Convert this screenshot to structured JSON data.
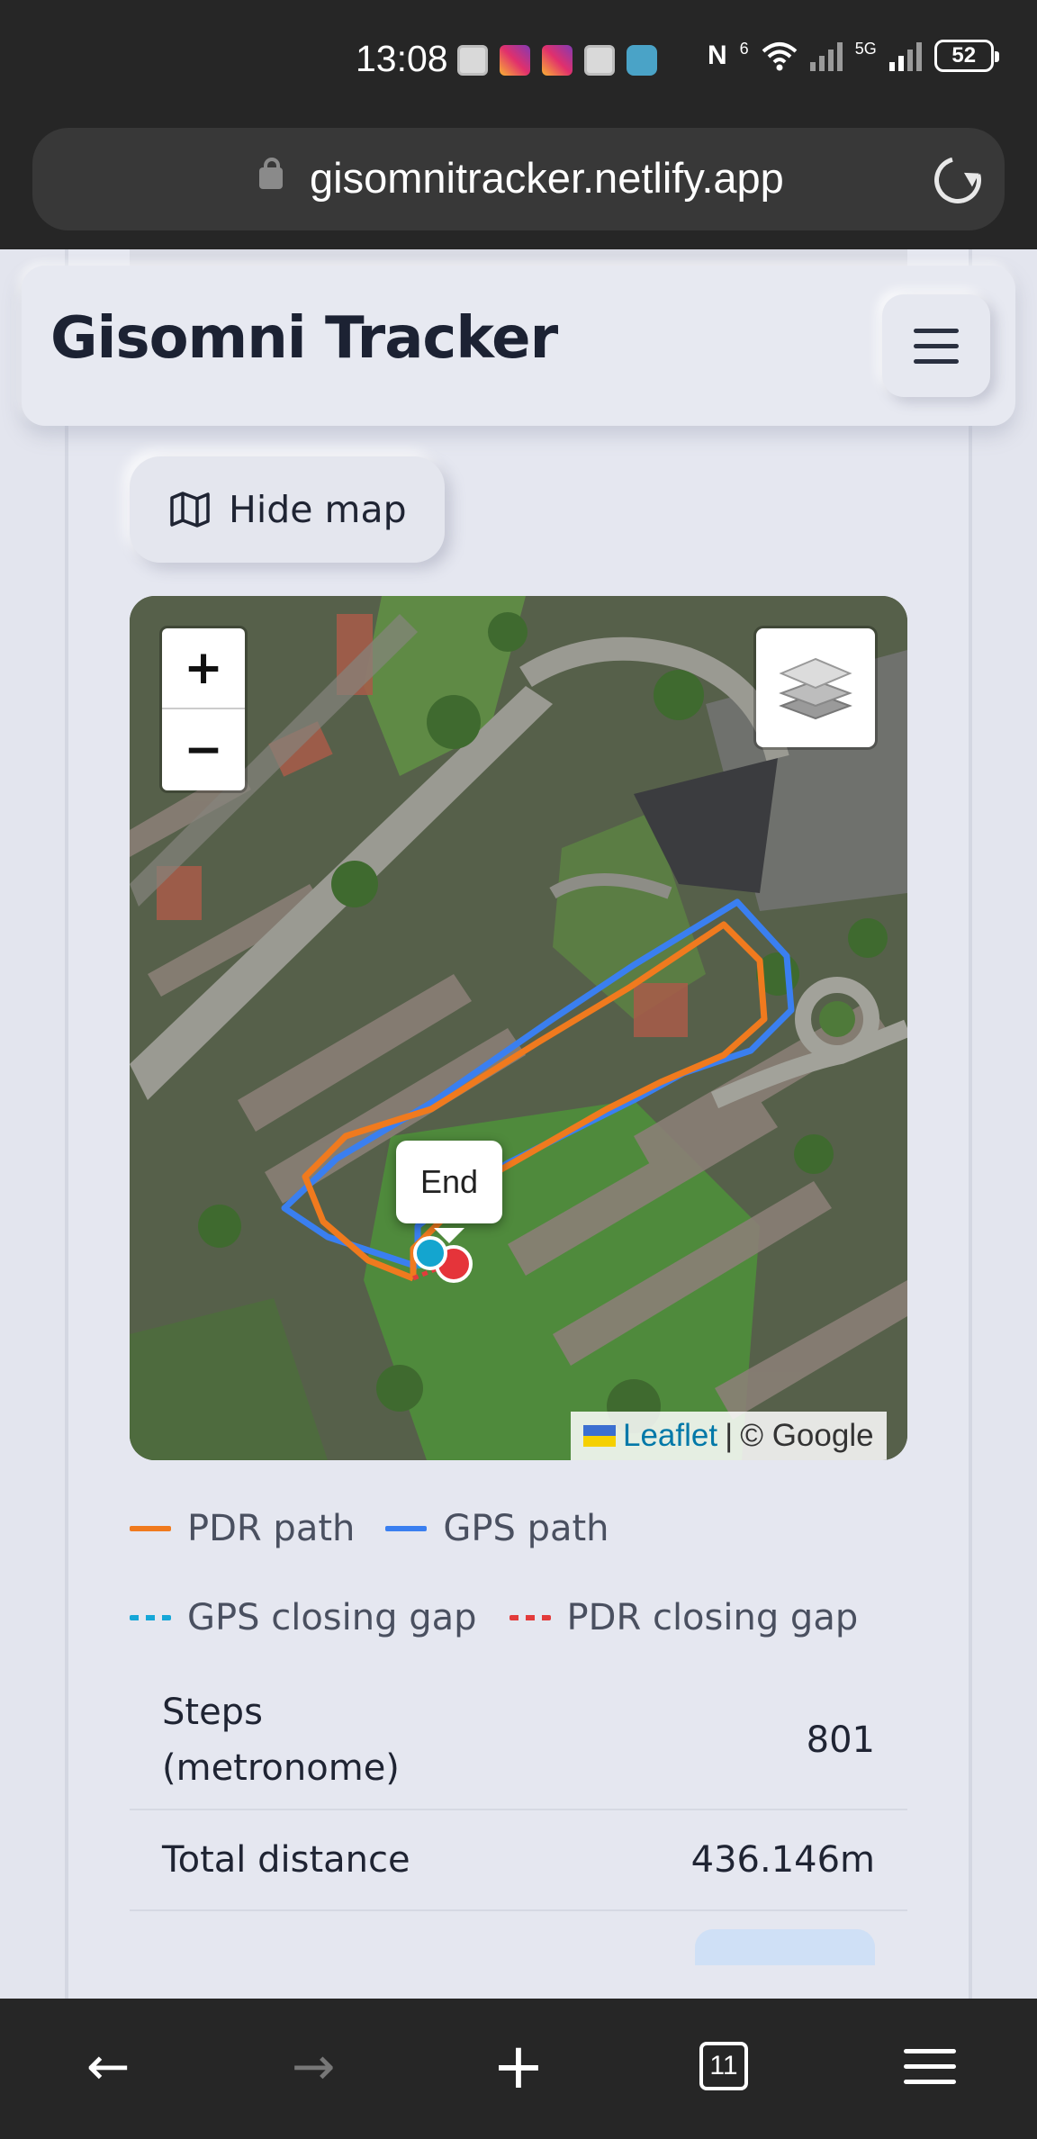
{
  "status_bar": {
    "time": "13:08",
    "notification_icons": [
      "mail-icon",
      "instagram-icon",
      "instagram-icon",
      "mail-icon",
      "chat-icon"
    ],
    "network_label": "5G",
    "wifi_label": "6",
    "battery": "52"
  },
  "browser": {
    "url": "gisomnitracker.netlify.app",
    "tab_count": "11"
  },
  "app": {
    "title": "Gisomni Tracker",
    "hide_map_label": "Hide map"
  },
  "map": {
    "popup_label": "End",
    "attribution_link": "Leaflet",
    "attribution_separator": "|",
    "attribution_source": "© Google",
    "zoom_in": "+",
    "zoom_out": "−"
  },
  "legend": [
    {
      "label": "PDR path",
      "color": "#f07a1e",
      "style": "solid"
    },
    {
      "label": "GPS path",
      "color": "#3a7ff0",
      "style": "solid"
    },
    {
      "label": "GPS closing gap",
      "color": "#16a7d8",
      "style": "dashed"
    },
    {
      "label": "PDR closing gap",
      "color": "#e33b3b",
      "style": "dashed"
    }
  ],
  "stats": [
    {
      "label_line1": "Steps",
      "label_line2": "(metronome)",
      "value": "801"
    },
    {
      "label_line1": "Total distance",
      "label_line2": "",
      "value": "436.146m"
    }
  ],
  "colors": {
    "pdr_path": "#f07a1e",
    "gps_path": "#3a7ff0",
    "start_marker": "#14a5cf",
    "end_marker": "#e5343a"
  }
}
